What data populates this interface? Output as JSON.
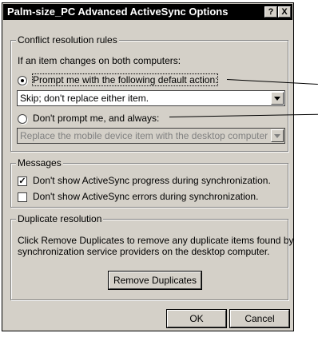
{
  "window": {
    "title": "Palm-size_PC Advanced ActiveSync Options",
    "help_glyph": "?",
    "close_glyph": "X"
  },
  "conflict": {
    "group_label": "Conflict resolution rules",
    "intro": "If an item changes on both computers:",
    "prompt_label": "Prompt me with the following default action:",
    "prompt_selected": true,
    "prompt_select_value": "Skip; don't replace either item.",
    "noprompt_label": "Don't prompt me, and always:",
    "noprompt_select_value": "Replace the mobile device item with the desktop computer item."
  },
  "messages": {
    "group_label": "Messages",
    "progress_label": "Don't show ActiveSync progress during synchronization.",
    "progress_checked": true,
    "errors_label": "Don't show ActiveSync errors during synchronization.",
    "errors_checked": false
  },
  "duplicates": {
    "group_label": "Duplicate resolution",
    "description_line1": "Click Remove Duplicates to remove any duplicate items found by",
    "description_line2": "synchronization service providers on the desktop computer.",
    "button_label": "Remove Duplicates"
  },
  "footer": {
    "ok_label": "OK",
    "cancel_label": "Cancel"
  },
  "icons": [
    "help-icon",
    "close-icon",
    "dropdown-arrow-icon"
  ]
}
